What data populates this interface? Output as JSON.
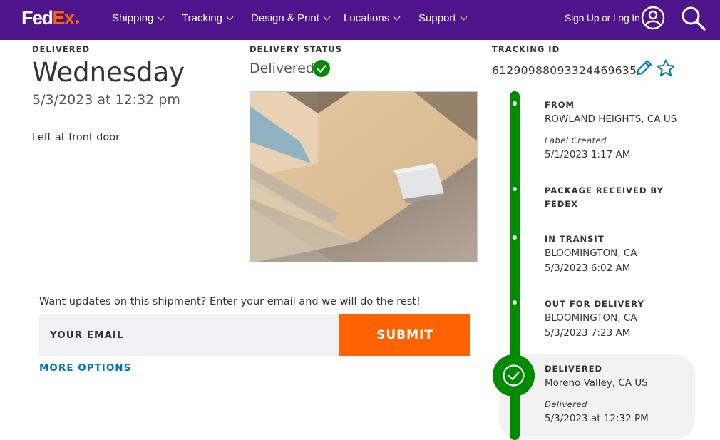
{
  "nav": {
    "logo_fed": "Fed",
    "logo_ex": "Ex",
    "items": [
      {
        "label": "Shipping"
      },
      {
        "label": "Tracking"
      },
      {
        "label": "Design & Print"
      },
      {
        "label": "Locations"
      },
      {
        "label": "Support"
      }
    ],
    "signin_label": "Sign Up or Log In",
    "icons": {
      "account": "user-icon",
      "search": "search-icon"
    }
  },
  "summary": {
    "delivered_label": "DELIVERED",
    "day": "Wednesday",
    "datetime": "5/3/2023 at 12:32 pm",
    "note": "Left at front door"
  },
  "status": {
    "label": "DELIVERY STATUS",
    "value": "Delivered"
  },
  "tracking": {
    "label": "TRACKING ID",
    "number": "612909880933244696​35",
    "icons": {
      "edit": "pencil-icon",
      "favorite": "star-icon"
    }
  },
  "signup": {
    "prompt": "Want updates on this shipment? Enter your email and we will do the rest!",
    "email_placeholder": "YOUR EMAIL",
    "submit_label": "SUBMIT",
    "more_options": "MORE OPTIONS"
  },
  "timeline": {
    "from_label": "FROM",
    "from_location": "ROWLAND HEIGHTS, CA US",
    "label_created": "Label Created",
    "label_created_time": "5/1/2023 1:17 AM",
    "received_line1": "PACKAGE RECEIVED BY",
    "received_line2": "FEDEX",
    "transit_label": "IN TRANSIT",
    "transit_location": "BLOOMINGTON, CA",
    "transit_time": "5/3/2023 6:02 AM",
    "out_label": "OUT FOR DELIVERY",
    "out_location": "BLOOMINGTON, CA",
    "out_time": "5/3/2023 7:23 AM",
    "delivered_label": "DELIVERED",
    "delivered_location": "Moreno Valley, CA US",
    "delivered_status": "Delivered",
    "delivered_time": "5/3/2023 at 12:32 PM"
  },
  "colors": {
    "brand_purple": "#4d148c",
    "brand_orange": "#ff6200",
    "success_green": "#008a00",
    "link_blue": "#007ab7"
  }
}
